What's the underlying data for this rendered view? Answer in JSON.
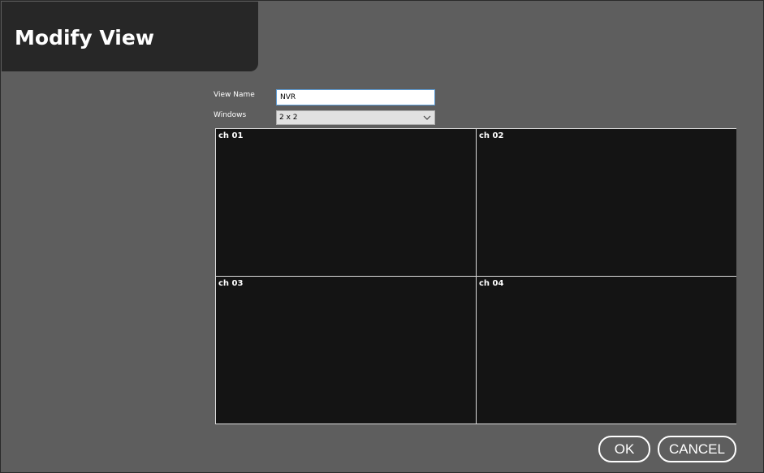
{
  "dialog": {
    "title": "Modify View"
  },
  "form": {
    "view_name_label": "View Name",
    "view_name_value": "NVR",
    "windows_label": "Windows",
    "windows_value": "2 x 2"
  },
  "channels": [
    {
      "label": "ch 01"
    },
    {
      "label": "ch 02"
    },
    {
      "label": "ch 03"
    },
    {
      "label": "ch 04"
    }
  ],
  "buttons": {
    "ok": "OK",
    "cancel": "CANCEL"
  },
  "colors": {
    "background": "#5e5e5e",
    "title_panel": "#272727",
    "video_cell": "#141414",
    "input_focus_border": "#5b9bd5"
  },
  "icons": {
    "select_arrow": "chevron-down-icon"
  }
}
